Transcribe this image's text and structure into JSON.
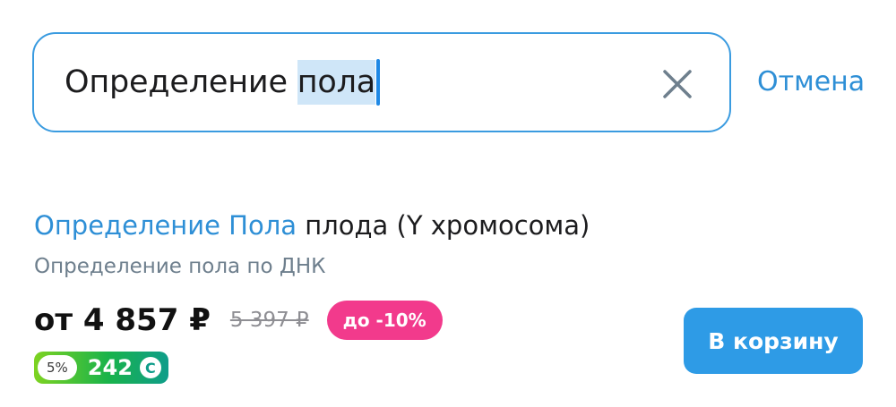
{
  "search": {
    "value_prefix": "Определение ",
    "value_selected": "пола",
    "clear_icon": "close-icon",
    "cancel_label": "Отмена"
  },
  "result": {
    "title_highlight": "Определение Пола",
    "title_rest": " плода (Y хромосома)",
    "subtitle": "Определение пола по ДНК",
    "price": "от 4 857 ₽",
    "old_price": "5 397 ₽",
    "discount": "до -10%",
    "cashback": {
      "percent": "5%",
      "value": "242",
      "icon": "coin-icon",
      "icon_glyph": "С"
    },
    "cart_button_label": "В корзину"
  },
  "colors": {
    "accent": "#2e8fd6",
    "discount_badge": "#f23a8c",
    "cart_button": "#2e9be6"
  }
}
